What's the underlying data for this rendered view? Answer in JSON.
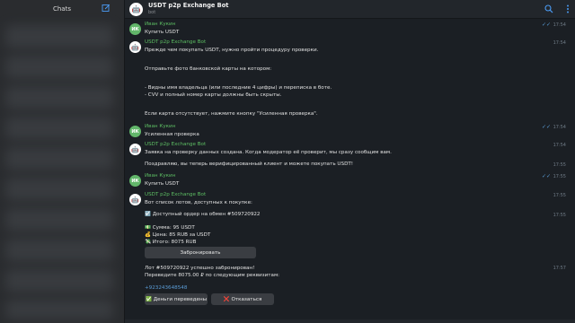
{
  "sidebar": {
    "title": "Chats"
  },
  "chat": {
    "title": "USDT p2p Exchange Bot",
    "subtitle": "bot"
  },
  "messages": {
    "m1": {
      "sender": "Иван Кукин",
      "avatar": "ИК",
      "text": "Купить USDT",
      "time": "17:54"
    },
    "m2": {
      "sender": "USDT p2p Exchange Bot",
      "time": "17:54",
      "l1": "Прежде чем покупать USDT, нужно пройти процедуру проверки.",
      "l2": "Отправьте фото банковской карты на котором:",
      "l3": "- Видны имя владельца (или последние 4 цифры) и переписка в боте.",
      "l4": "- CVV и полный номер карты должны быть скрыты.",
      "l5": "Если карта отсутствует, нажмите кнопку \"Усиленная проверка\"."
    },
    "m3": {
      "sender": "Иван Кукин",
      "avatar": "ИК",
      "text": "Усиленная проверка",
      "time": "17:54"
    },
    "m4": {
      "sender": "USDT p2p Exchange Bot",
      "time": "17:54",
      "l1": "Заявка на проверку данных создана. Когда модератор её проверит, мы сразу сообщим вам.",
      "l2": "Поздравляю, вы теперь верифицированный клиент и можете покупать USDT!",
      "time2": "17:55"
    },
    "m5": {
      "sender": "Иван Кукин",
      "avatar": "ИК",
      "text": "Купить USDT",
      "time": "17:55"
    },
    "m6": {
      "sender": "USDT p2p Exchange Bot",
      "time": "17:55",
      "l1": "Вот список лотов, доступных к покупке:",
      "l2": "Доступный ордер на обмен #509720922",
      "time2": "17:55",
      "l3": "Сумма: 95 USDT",
      "l4": "Цена: 85 RUB за USDT",
      "l5": "Итого: 8075 RUB",
      "button_reserve": "Забронировать",
      "l6": "Лот #509720922 успешно забронирован!",
      "l7": "Переведите 8075.00 ₽ по следующим реквизитам:",
      "time3": "17:57",
      "link": "+923243648548",
      "button_paid": "Деньги переведены",
      "button_cancel": "Отказаться"
    }
  }
}
